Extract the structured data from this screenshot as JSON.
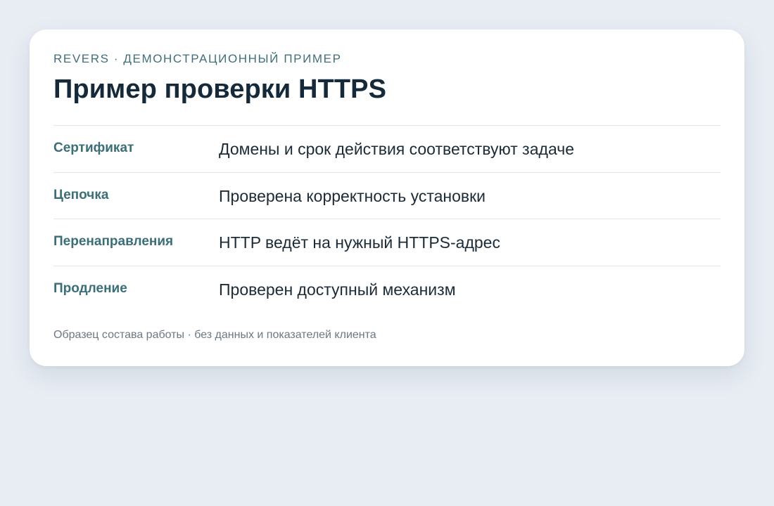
{
  "card": {
    "eyebrow": "REVERS · ДЕМОНСТРАЦИОННЫЙ ПРИМЕР",
    "title": "Пример проверки HTTPS",
    "rows": [
      {
        "label": "Сертификат",
        "value": "Домены и срок действия соответствуют задаче"
      },
      {
        "label": "Цепочка",
        "value": "Проверена корректность установки"
      },
      {
        "label": "Перенаправления",
        "value": "HTTP ведёт на нужный HTTPS-адрес"
      },
      {
        "label": "Продление",
        "value": "Проверен доступный механизм"
      }
    ],
    "footnote": "Образец состава работы · без данных и показателей клиента"
  }
}
